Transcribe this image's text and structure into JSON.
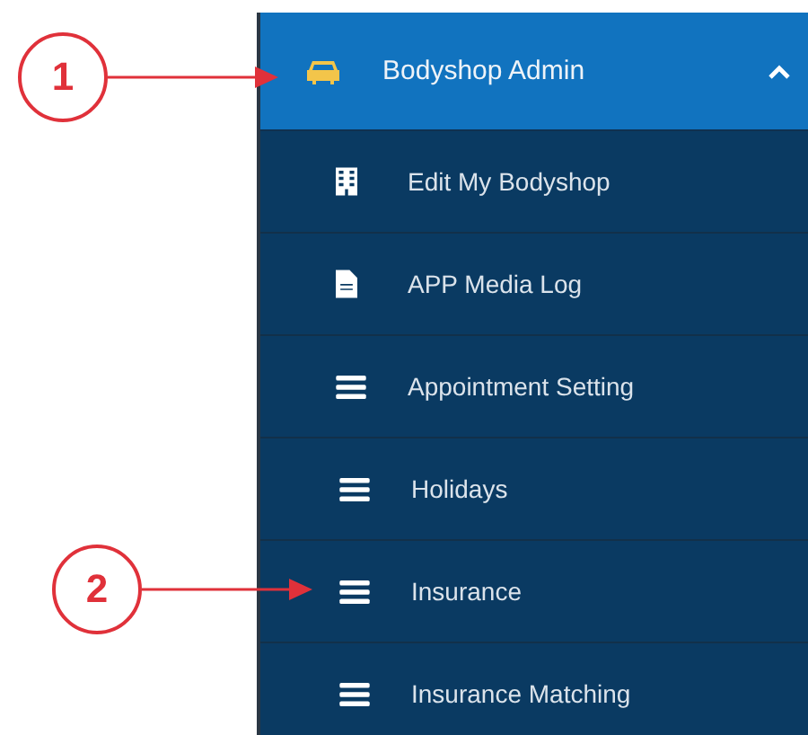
{
  "menu": {
    "header": {
      "label": "Bodyshop Admin",
      "expanded": true,
      "callout": "1"
    },
    "items": [
      {
        "label": "Edit My Bodyshop",
        "kind": "building"
      },
      {
        "label": "APP Media Log",
        "kind": "file"
      },
      {
        "label": "Appointment Setting",
        "kind": "list"
      },
      {
        "label": "Holidays",
        "kind": "list"
      },
      {
        "label": "Insurance",
        "kind": "list",
        "callout": "2"
      },
      {
        "label": "Insurance Matching",
        "kind": "list"
      }
    ]
  }
}
